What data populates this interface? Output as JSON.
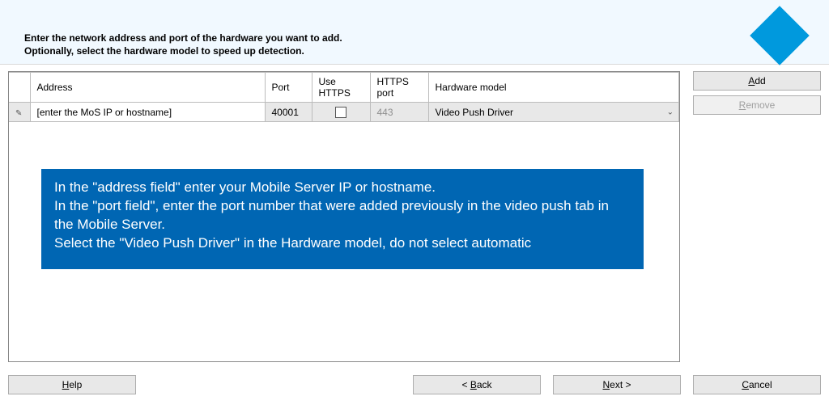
{
  "instructions": {
    "line1": "Enter the network address and port of the hardware you want to add.",
    "line2": "Optionally, select the hardware model to speed up detection."
  },
  "table": {
    "headers": {
      "address": "Address",
      "port": "Port",
      "use_https": "Use HTTPS",
      "https_port": "HTTPS port",
      "model": "Hardware model"
    },
    "row": {
      "address": "[enter the MoS IP or hostname]",
      "port": "40001",
      "https_port": "443",
      "model": "Video Push Driver"
    }
  },
  "side_buttons": {
    "add_prefix": "",
    "add_u": "A",
    "add_suffix": "dd",
    "remove_prefix": "",
    "remove_u": "R",
    "remove_suffix": "emove"
  },
  "callout": {
    "l1": "In the \"address field\" enter your Mobile Server IP or hostname.",
    "l2": "In the \"port field\", enter the port number that were added previously in the video push tab in the Mobile Server.",
    "l3": "Select the \"Video Push Driver\" in the Hardware model, do not select automatic"
  },
  "bottom": {
    "help_u": "H",
    "help_suffix": "elp",
    "back_prefix": "< ",
    "back_u": "B",
    "back_suffix": "ack",
    "next_u": "N",
    "next_suffix": "ext >",
    "cancel_u": "C",
    "cancel_suffix": "ancel"
  }
}
